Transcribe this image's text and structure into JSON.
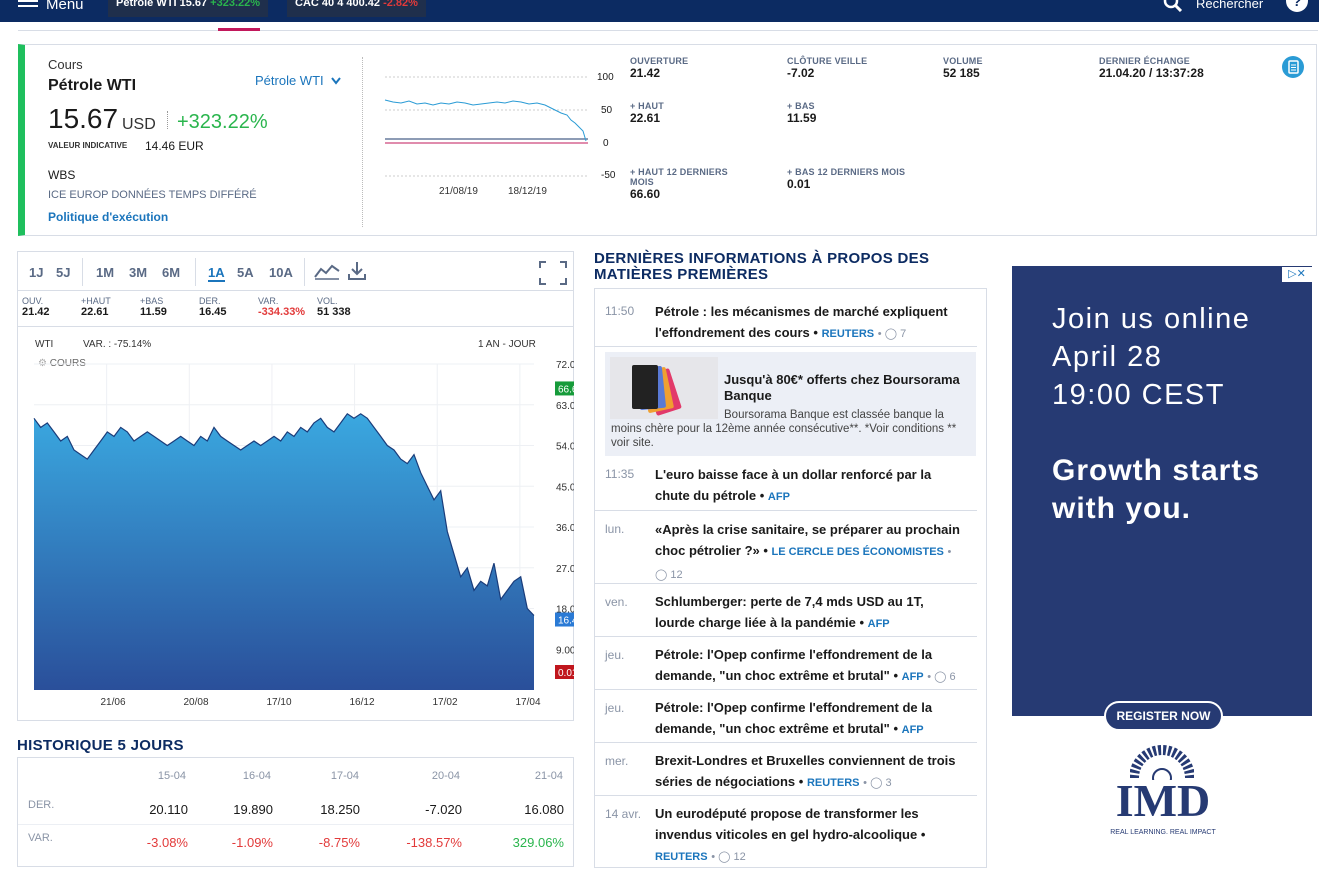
{
  "topbar": {
    "menu_label": "Menu",
    "tickers": [
      {
        "name": "Pétrole WTI",
        "price": "15.67",
        "change": "+323.22%"
      },
      {
        "name": "CAC 40",
        "price": "4 400.42",
        "change": "-2.82%"
      }
    ],
    "search_label": "Rechercher",
    "help": "?"
  },
  "quote": {
    "heading": "Cours",
    "name": "Pétrole WTI",
    "selector": "Pétrole WTI",
    "price": "15.67",
    "currency": "USD",
    "change": "+323.22%",
    "indicative_label": "VALEUR INDICATIVE",
    "indicative_value": "14.46 EUR",
    "ticker_code": "WBS",
    "market": "ICE EUROP DONNÉES TEMPS DIFFÉRÉ",
    "policy_link": "Politique d'exécution",
    "mini_chart": {
      "y_ticks": [
        "100",
        "50",
        "0",
        "-50"
      ],
      "x_ticks": [
        "21/08/19",
        "18/12/19"
      ]
    },
    "stats": [
      {
        "label": "OUVERTURE",
        "value": "21.42"
      },
      {
        "label": "CLÔTURE VEILLE",
        "value": "-7.02"
      },
      {
        "label": "VOLUME",
        "value": "52 185"
      },
      {
        "label": "DERNIER ÉCHANGE",
        "value": "21.04.20 / 13:37:28"
      },
      {
        "label": "+ HAUT",
        "value": "22.61"
      },
      {
        "label": "+ BAS",
        "value": "11.59"
      },
      {
        "label": "+ HAUT 12 DERNIERS MOIS",
        "value": "66.60"
      },
      {
        "label": "+ BAS 12 DERNIERS MOIS",
        "value": "0.01"
      }
    ]
  },
  "chart_panel": {
    "periods": [
      "1J",
      "5J",
      "1M",
      "3M",
      "6M",
      "1A",
      "5A",
      "10A"
    ],
    "active_period": "1A",
    "stats": [
      {
        "label": "OUV.",
        "value": "21.42"
      },
      {
        "label": "+HAUT",
        "value": "22.61"
      },
      {
        "label": "+BAS",
        "value": "11.59"
      },
      {
        "label": "DER.",
        "value": "16.45"
      },
      {
        "label": "VAR.",
        "value": "-334.33%"
      },
      {
        "label": "VOL.",
        "value": "51 338"
      }
    ],
    "symbol": "WTI",
    "var_label": "VAR. : -75.14%",
    "range_label": "1 AN - JOUR",
    "legend": "COURS",
    "markers": {
      "high": "66.60",
      "last": "16.45",
      "low": "0.010"
    }
  },
  "chart_data": {
    "type": "area",
    "ylabel": "",
    "xlabel": "",
    "ylim": [
      0,
      72
    ],
    "y_ticks": [
      "72.00",
      "63.00",
      "54.00",
      "45.00",
      "36.00",
      "27.00",
      "18.00",
      "9.00"
    ],
    "x_ticks": [
      "21/06",
      "20/08",
      "17/10",
      "16/12",
      "17/02",
      "17/04"
    ],
    "series": [
      {
        "values": [
          60,
          58,
          59,
          57,
          55,
          56,
          53,
          52,
          51,
          53,
          55,
          57,
          56,
          58,
          57,
          55,
          56,
          57,
          56,
          55,
          54,
          55,
          56,
          55,
          54,
          56,
          55,
          58,
          56,
          55,
          54,
          53,
          54,
          55,
          54,
          55,
          56,
          55,
          57,
          56,
          58,
          57,
          59,
          60,
          58,
          57,
          59,
          61,
          60,
          61,
          60,
          58,
          56,
          54,
          53,
          51,
          50,
          52,
          48,
          45,
          42,
          44,
          35,
          30,
          25,
          27,
          22,
          24,
          23,
          28,
          20,
          22,
          24,
          25,
          18,
          16.45
        ]
      }
    ]
  },
  "history": {
    "title": "HISTORIQUE 5 JOURS",
    "dates": [
      "15-04",
      "16-04",
      "17-04",
      "20-04",
      "21-04"
    ],
    "rows": [
      {
        "label": "DER.",
        "values": [
          "20.110",
          "19.890",
          "18.250",
          "-7.020",
          "16.080"
        ]
      },
      {
        "label": "VAR.",
        "values": [
          "-3.08%",
          "-1.09%",
          "-8.75%",
          "-138.57%",
          "329.06%"
        ]
      }
    ]
  },
  "news": {
    "title": "DERNIÈRES INFORMATIONS À PROPOS DES MATIÈRES PREMIÈRES",
    "items": [
      {
        "time": "11:50",
        "text": "Pétrole : les mécanismes de marché expliquent l'effondrement des cours",
        "source": "REUTERS",
        "comments": "7"
      },
      {
        "time": "11:35",
        "text": "L'euro baisse face à un dollar renforcé par la chute du pétrole",
        "source": "AFP",
        "comments": ""
      },
      {
        "time": "lun.",
        "text": "«Après la crise sanitaire, se préparer au prochain choc pétrolier ?»",
        "source": "LE CERCLE DES ÉCONOMISTES",
        "comments": "12"
      },
      {
        "time": "ven.",
        "text": "Schlumberger: perte de 7,4 mds USD au 1T, lourde charge liée à la pandémie",
        "source": "AFP",
        "comments": ""
      },
      {
        "time": "jeu.",
        "text": "Pétrole: l'Opep confirme l'effondrement de la demande, \"un choc extrême et brutal\"",
        "source": "AFP",
        "comments": "6"
      },
      {
        "time": "jeu.",
        "text": "Pétrole: l'Opep confirme l'effondrement de la demande, \"un choc extrême et brutal\"",
        "source": "AFP",
        "comments": ""
      },
      {
        "time": "mer.",
        "text": "Brexit-Londres et Bruxelles conviennent de trois séries de négociations",
        "source": "REUTERS",
        "comments": "3"
      },
      {
        "time": "14 avr.",
        "text": "Un eurodéputé propose de transformer les invendus viticoles en gel hydro-alcoolique",
        "source": "REUTERS",
        "comments": "12"
      }
    ],
    "promo": {
      "title": "Jusqu'à 80€* offerts chez Boursorama Banque",
      "body": "Boursorama Banque est classée banque la moins chère pour la 12ème année consécutive**. *Voir conditions ** voir site."
    }
  },
  "ad": {
    "line1": "Join us online",
    "line2": "April 28",
    "line3": "19:00 CEST",
    "headline1": "Growth starts",
    "headline2": "with you.",
    "cta": "REGISTER NOW",
    "logo": "IMD",
    "tagline": "REAL LEARNING. REAL IMPACT"
  },
  "colors": {
    "navy": "#0c2b62",
    "green": "#1fbf5d",
    "blue": "#1b75bc",
    "red": "#e23a3a",
    "chart": "#2e7fc4"
  }
}
